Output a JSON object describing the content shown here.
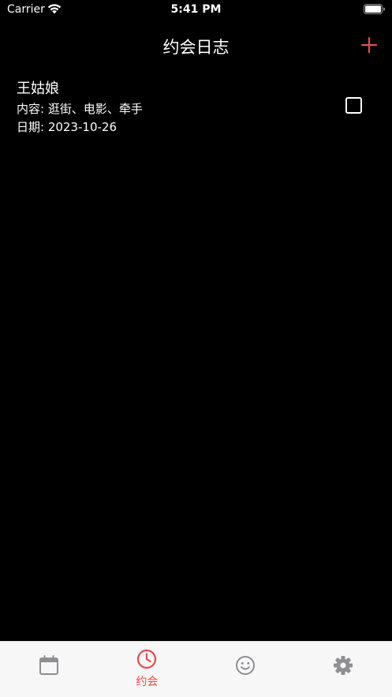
{
  "status_bar": {
    "carrier": "Carrier",
    "time": "5:41 PM",
    "wifi_icon": "wifi-icon",
    "battery_icon": "battery-full-icon"
  },
  "nav": {
    "title": "约会日志",
    "add_icon": "plus-icon",
    "accent_color": "#e94a4a"
  },
  "entries": [
    {
      "name": "王姑娘",
      "content": "内容: 逛街、电影、牵手",
      "date": "日期: 2023-10-26",
      "checked": false
    }
  ],
  "tab_bar": {
    "active_color": "#e94a4a",
    "inactive_color": "#8e8e93",
    "tabs": [
      {
        "icon": "calendar-icon",
        "label": "",
        "active": false
      },
      {
        "icon": "clock-icon",
        "label": "约会",
        "active": true
      },
      {
        "icon": "smiley-icon",
        "label": "",
        "active": false
      },
      {
        "icon": "gear-icon",
        "label": "",
        "active": false
      }
    ]
  }
}
